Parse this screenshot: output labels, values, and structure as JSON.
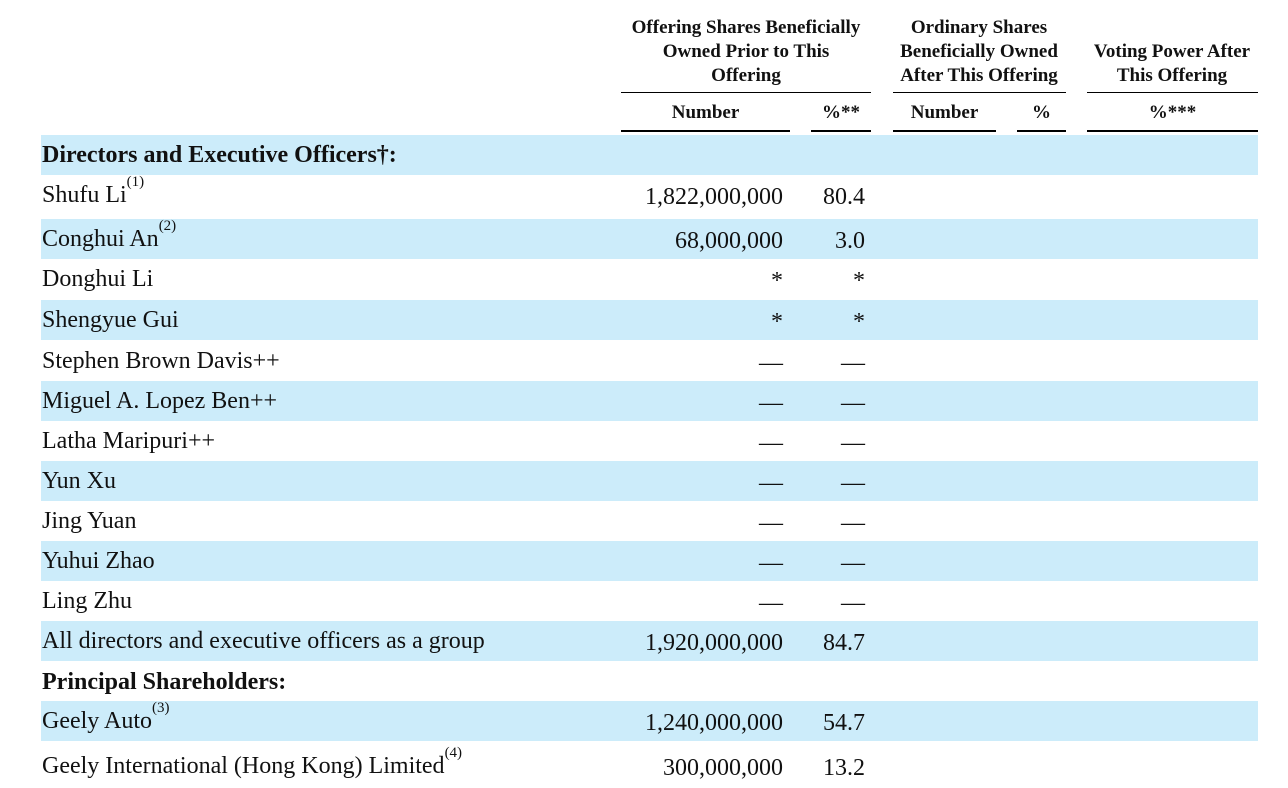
{
  "header": {
    "col_group1": [
      "Offering Shares Beneficially",
      "Owned Prior to This",
      "Offering"
    ],
    "col_group2": [
      "Ordinary Shares",
      "Beneficially Owned",
      "After This Offering"
    ],
    "col_group3": [
      "Voting Power After",
      "This Offering"
    ],
    "sub_number1": "Number",
    "sub_pct1": "%**",
    "sub_number2": "Number",
    "sub_pct2": "%",
    "sub_pct3": "%***"
  },
  "rows": [
    {
      "name": "Directors and Executive Officers†:",
      "footnote": "",
      "number": "",
      "pct": "",
      "section": true
    },
    {
      "name": "Shufu Li",
      "footnote": "(1)",
      "number": "1,822,000,000",
      "pct": "80.4"
    },
    {
      "name": "Conghui An",
      "footnote": "(2)",
      "number": "68,000,000",
      "pct": "3.0"
    },
    {
      "name": "Donghui Li",
      "footnote": "",
      "number": "*",
      "pct": "*"
    },
    {
      "name": "Shengyue Gui",
      "footnote": "",
      "number": "*",
      "pct": "*"
    },
    {
      "name": "Stephen Brown Davis++",
      "footnote": "",
      "number": "—",
      "pct": "—"
    },
    {
      "name": "Miguel A. Lopez Ben++",
      "footnote": "",
      "number": "—",
      "pct": "—"
    },
    {
      "name": "Latha Maripuri++",
      "footnote": "",
      "number": "—",
      "pct": "—"
    },
    {
      "name": "Yun Xu",
      "footnote": "",
      "number": "—",
      "pct": "—"
    },
    {
      "name": "Jing Yuan",
      "footnote": "",
      "number": "—",
      "pct": "—"
    },
    {
      "name": "Yuhui Zhao",
      "footnote": "",
      "number": "—",
      "pct": "—"
    },
    {
      "name": "Ling Zhu",
      "footnote": "",
      "number": "—",
      "pct": "—"
    },
    {
      "name": "All directors and executive officers as a group",
      "footnote": "",
      "number": "1,920,000,000",
      "pct": "84.7"
    },
    {
      "name": "Principal Shareholders:",
      "footnote": "",
      "number": "",
      "pct": "",
      "section": true
    },
    {
      "name": "Geely Auto",
      "footnote": "(3)",
      "number": "1,240,000,000",
      "pct": "54.7"
    },
    {
      "name": "Geely International (Hong Kong) Limited",
      "footnote": "(4)",
      "number": "300,000,000",
      "pct": "13.2"
    }
  ],
  "colors": {
    "row_shade": "#ccecfa",
    "text": "#111111"
  }
}
